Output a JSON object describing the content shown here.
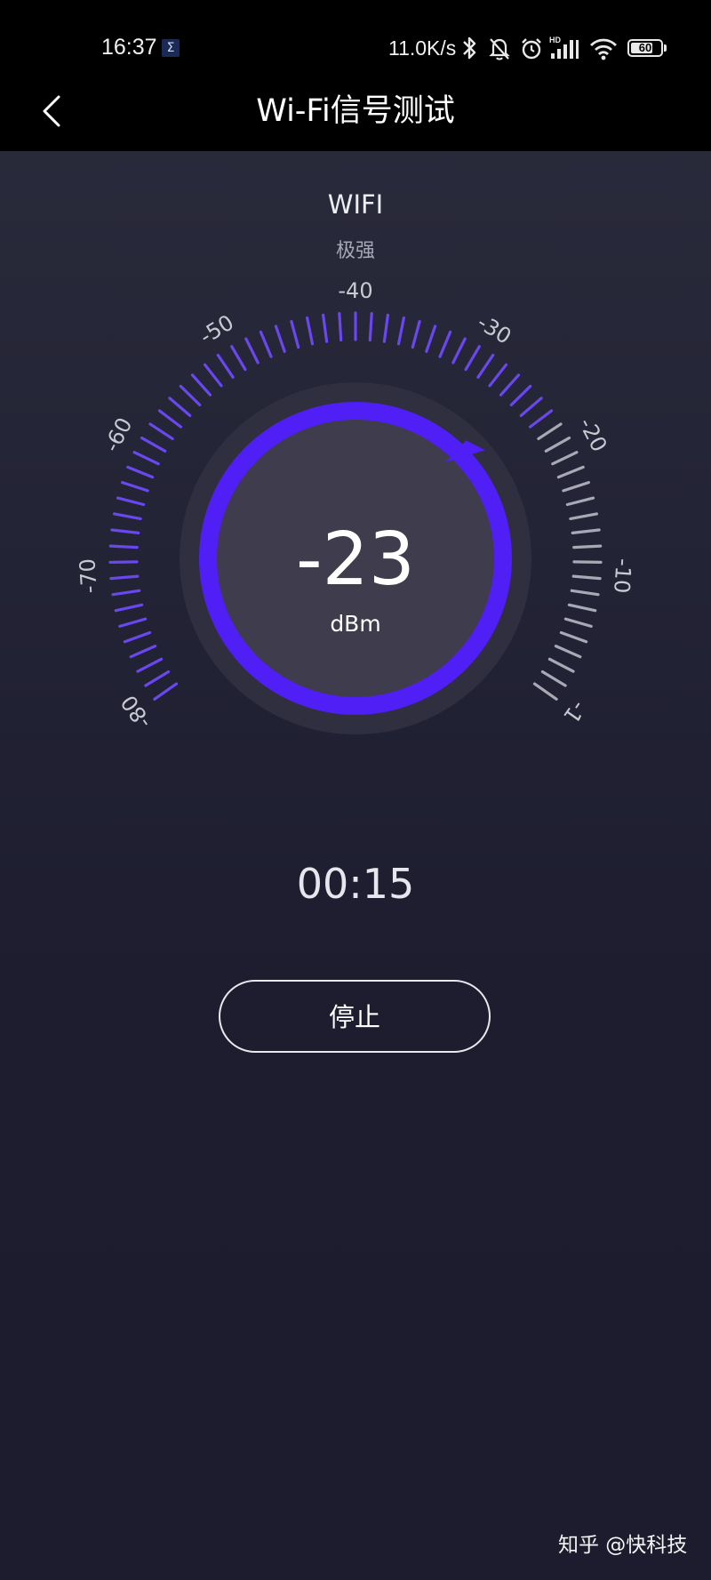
{
  "status_bar": {
    "time": "16:37",
    "notification_glyph": "Σ",
    "net_speed": "11.0K/s",
    "battery": "60",
    "icons": [
      "bluetooth-icon",
      "mute-bell-icon",
      "alarm-icon",
      "hd-cellular-signal-icon",
      "wifi-icon",
      "battery-icon"
    ]
  },
  "app_bar": {
    "title": "Wi-Fi信号测试",
    "back_icon": "chevron-left-icon"
  },
  "network": {
    "type": "WIFI",
    "strength_label": "极强"
  },
  "gauge": {
    "value": "-23",
    "value_number": -23,
    "unit": "dBm",
    "scale_labels": [
      "-80",
      "-70",
      "-60",
      "-50",
      "-40",
      "-30",
      "-20",
      "-10",
      "-1"
    ],
    "min": -80,
    "max": -1,
    "active_color": "#6a47ee",
    "inactive_color": "#a9a9b5",
    "ring_color": "#4f1ff6",
    "dial_color": "#3e3c4d"
  },
  "timer": {
    "elapsed": "00:15"
  },
  "actions": {
    "stop_label": "停止"
  },
  "watermark": "知乎 @快科技"
}
